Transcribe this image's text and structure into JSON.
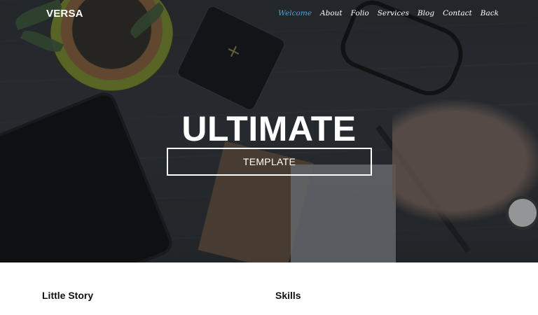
{
  "brand": "VERSA",
  "nav": {
    "items": [
      {
        "label": "Welcome",
        "active": true
      },
      {
        "label": "About"
      },
      {
        "label": "Folio"
      },
      {
        "label": "Services"
      },
      {
        "label": "Blog"
      },
      {
        "label": "Contact"
      },
      {
        "label": "Back"
      }
    ],
    "accent_color": "#4aa3df"
  },
  "hero": {
    "headline": "ULTIMATE",
    "cta_label": "TEMPLATE"
  },
  "sections": {
    "story_title": "Little Story",
    "skills_title": "Skills"
  }
}
